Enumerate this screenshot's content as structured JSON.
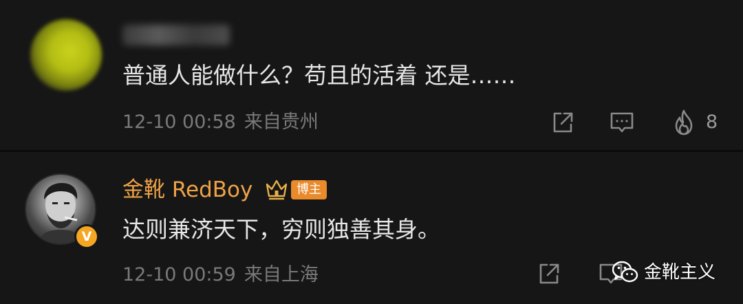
{
  "comments": [
    {
      "text": "普通人能做什么？苟且的活着 还是……",
      "time": "12-10 00:58",
      "location": "来自贵州",
      "like_count": "8"
    },
    {
      "username": "金靴 RedBoy",
      "blogger_tag": "博主",
      "verified_mark": "V",
      "text": "达则兼济天下，穷则独善其身。",
      "time": "12-10 00:59",
      "location": "来自上海"
    }
  ],
  "watermark": {
    "text": "金靴主义",
    "icon": "wechat-icon"
  },
  "icons": {
    "share": "share-icon",
    "reply": "comment-icon",
    "like": "flame-like-icon",
    "crown": "crown-badge-icon"
  },
  "colors": {
    "background": "#161616",
    "username": "#f0a347",
    "tag": "#e98a2b",
    "meta": "#7a7a7a",
    "text": "#e6e6e6"
  }
}
